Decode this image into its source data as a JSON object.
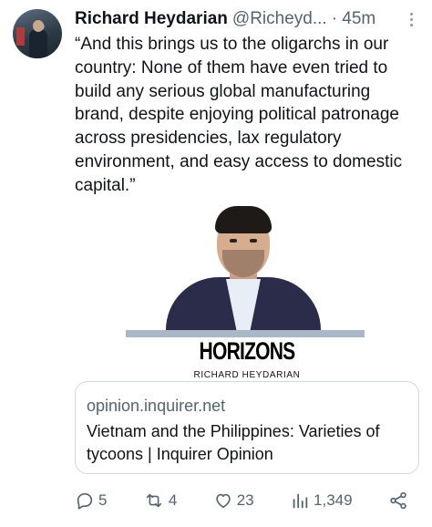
{
  "tweet": {
    "author_name": "Richard Heydarian",
    "author_handle": "@Richeyd...",
    "time": "· 45m",
    "text": "“And this brings us to the oligarchs in our country: None of them have even tried to build any serious global manufacturing brand, despite enjoying political patronage across presidencies, lax regulatory environment, and easy access to domestic capital.”"
  },
  "media": {
    "brand": "HORIZONS",
    "byline": "RICHARD HEYDARIAN"
  },
  "link_card": {
    "domain": "opinion.inquirer.net",
    "title": "Vietnam and the Philippines: Varieties of tycoons | Inquirer Opinion"
  },
  "actions": {
    "replies": "5",
    "reposts": "4",
    "likes": "23",
    "views": "1,349"
  },
  "colors": {
    "text": "#0f1419",
    "secondary": "#536471",
    "border": "#cfd9de"
  },
  "icons": [
    "more-icon",
    "reply-icon",
    "repost-icon",
    "like-icon",
    "views-icon",
    "share-icon"
  ]
}
